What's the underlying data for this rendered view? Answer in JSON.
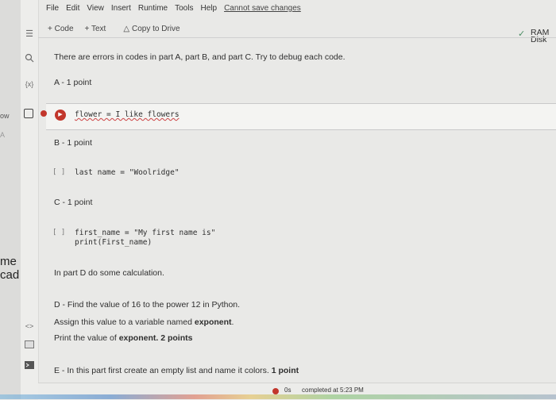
{
  "menubar": [
    "File",
    "Edit",
    "View",
    "Insert",
    "Runtime",
    "Tools",
    "Help"
  ],
  "unsaved_label": "Cannot save changes",
  "toolbar": {
    "code_label": "+ Code",
    "text_label": "+ Text",
    "copy_label": "Copy to Drive"
  },
  "resources": {
    "ram": "RAM",
    "disk": "Disk"
  },
  "background_window": {
    "fragment_top": "ow",
    "fragment_a": "A",
    "fragment_1": "me",
    "fragment_2": "cad"
  },
  "cells": {
    "intro": "There are errors in codes in part A, part B, and part C. Try to debug each code.",
    "a_heading": "A - 1 point",
    "a_code": "flower = I like flowers",
    "b_heading": "B - 1 point",
    "b_code": "last name = \"Woolridge\"",
    "c_heading": "C - 1 point",
    "c_code_1": "first_name = \"My first name is\"",
    "c_code_2": "print(First_name)",
    "d_intro": "In part D do some calculation.",
    "d_line1": "D - Find the value of 16 to the power 12 in Python.",
    "d_line2_a": "Assign this value to a variable named ",
    "d_line2_b": "exponent",
    "d_line3_a": "Print the value of ",
    "d_line3_b": "exponent",
    "d_line3_c": ". 2 points",
    "e_line_a": "E - In this part first create an empty list and name it colors. ",
    "e_line_b": "1 point",
    "bracket": "[ ]"
  },
  "status": {
    "time": "0s",
    "text": "completed at 5:23 PM"
  },
  "colors": {
    "error": "#c2362b",
    "check": "#4a8d63"
  },
  "icons": [
    "menu-icon",
    "search-icon",
    "variables-icon",
    "code-snippets-icon",
    "terminal-icon",
    "run-icon",
    "error-icon",
    "check-icon",
    "drive-icon"
  ]
}
